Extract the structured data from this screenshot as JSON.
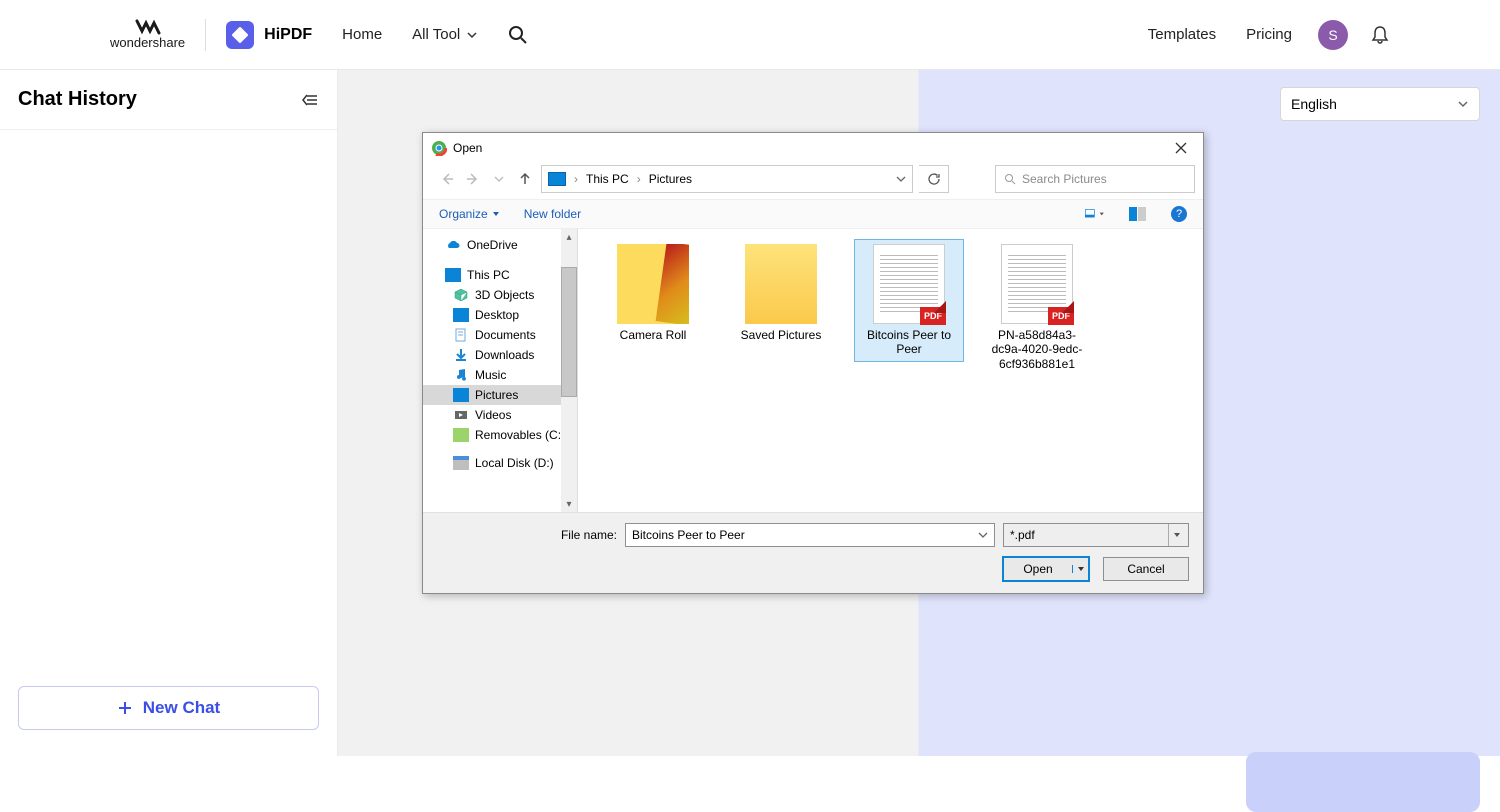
{
  "topbar": {
    "wondershare": "wondershare",
    "hipdf": "HiPDF",
    "home": "Home",
    "all_tool": "All Tool",
    "templates": "Templates",
    "pricing": "Pricing",
    "avatar_letter": "S"
  },
  "sidebar": {
    "title": "Chat History",
    "new_chat": "New Chat"
  },
  "language_select": {
    "value": "English"
  },
  "dialog": {
    "title": "Open",
    "breadcrumb": {
      "root": "This PC",
      "folder": "Pictures"
    },
    "search_placeholder": "Search Pictures",
    "organize": "Organize",
    "new_folder": "New folder",
    "tree": {
      "onedrive": "OneDrive",
      "thispc": "This PC",
      "objects3d": "3D Objects",
      "desktop": "Desktop",
      "documents": "Documents",
      "downloads": "Downloads",
      "music": "Music",
      "pictures": "Pictures",
      "videos": "Videos",
      "removables": "Removables (C:)",
      "localdisk": "Local Disk (D:)"
    },
    "files": {
      "camera_roll": "Camera Roll",
      "saved_pictures": "Saved Pictures",
      "bitcoins": "Bitcoins Peer to Peer",
      "pn_doc": "PN-a58d84a3-dc9a-4020-9edc-6cf936b881e1",
      "pdf_badge": "PDF"
    },
    "filename_label": "File name:",
    "filename_value": "Bitcoins Peer to Peer",
    "filter": "*.pdf",
    "open_btn": "Open",
    "cancel_btn": "Cancel"
  }
}
